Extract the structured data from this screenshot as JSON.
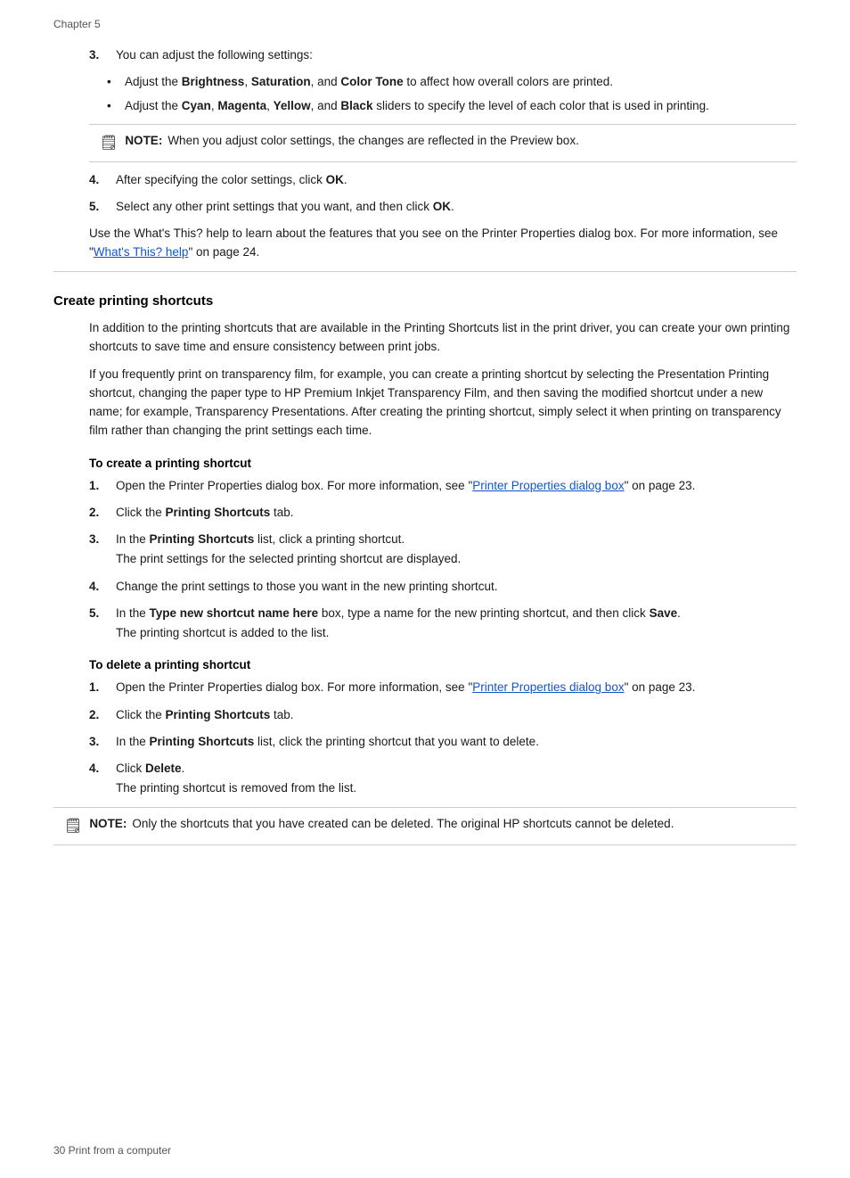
{
  "chapter": "Chapter 5",
  "footer": "30    Print from a computer",
  "step3_intro": "You can adjust the following settings:",
  "bullet1": "Adjust the ",
  "bullet1_bold": "Brightness",
  "bullet1_and": ", ",
  "bullet1_bold2": "Saturation",
  "bullet1_and2": ", and ",
  "bullet1_bold3": "Color Tone",
  "bullet1_rest": " to affect how overall colors are printed.",
  "bullet2": "Adjust the ",
  "bullet2_bold1": "Cyan",
  "bullet2_and1": ", ",
  "bullet2_bold2": "Magenta",
  "bullet2_and2": ", ",
  "bullet2_bold3": "Yellow",
  "bullet2_and3": ", and ",
  "bullet2_bold4": "Black",
  "bullet2_rest": " sliders to specify the level of each color that is used in printing.",
  "note1_label": "NOTE:",
  "note1_text": "When you adjust color settings, the changes are reflected in the Preview box.",
  "step4": "After specifying the color settings, click ",
  "step4_bold": "OK",
  "step4_end": ".",
  "step5": "Select any other print settings that you want, and then click ",
  "step5_bold": "OK",
  "step5_end": ".",
  "para_whatsthis": "Use the What's This? help to learn about the features that you see on the Printer Properties dialog box. For more information, see “",
  "whatsthis_link": "What's This? help",
  "whatsthis_link_ref": " on page 24",
  "whatsthis_end": ".",
  "section_title": "Create printing shortcuts",
  "intro_para1": "In addition to the printing shortcuts that are available in the Printing Shortcuts list in the print driver, you can create your own printing shortcuts to save time and ensure consistency between print jobs.",
  "intro_para2": "If you frequently print on transparency film, for example, you can create a printing shortcut by selecting the Presentation Printing shortcut, changing the paper type to HP Premium Inkjet Transparency Film, and then saving the modified shortcut under a new name; for example, Transparency Presentations. After creating the printing shortcut, simply select it when printing on transparency film rather than changing the print settings each time.",
  "create_heading": "To create a printing shortcut",
  "create_step1_pre": "Open the Printer Properties dialog box. For more information, see “",
  "create_step1_link": "Printer Properties dialog box",
  "create_step1_ref": "” on page 23",
  "create_step1_end": ".",
  "create_step2": "Click the ",
  "create_step2_bold": "Printing Shortcuts",
  "create_step2_end": " tab.",
  "create_step3": "In the ",
  "create_step3_bold": "Printing Shortcuts",
  "create_step3_rest": " list, click a printing shortcut.",
  "create_step3_sub": "The print settings for the selected printing shortcut are displayed.",
  "create_step4": "Change the print settings to those you want in the new printing shortcut.",
  "create_step5": "In the ",
  "create_step5_bold": "Type new shortcut name here",
  "create_step5_rest": " box, type a name for the new printing shortcut, and then click ",
  "create_step5_save": "Save",
  "create_step5_end": ".",
  "create_step5_sub": "The printing shortcut is added to the list.",
  "delete_heading": "To delete a printing shortcut",
  "delete_step1_pre": "Open the Printer Properties dialog box. For more information, see “",
  "delete_step1_link": "Printer Properties dialog box",
  "delete_step1_ref": "” on page 23",
  "delete_step1_end": ".",
  "delete_step2": "Click the ",
  "delete_step2_bold": "Printing Shortcuts",
  "delete_step2_end": " tab.",
  "delete_step3": "In the ",
  "delete_step3_bold": "Printing Shortcuts",
  "delete_step3_rest": " list, click the printing shortcut that you want to delete.",
  "delete_step4": "Click ",
  "delete_step4_bold": "Delete",
  "delete_step4_end": ".",
  "delete_step4_sub": "The printing shortcut is removed from the list.",
  "note2_label": "NOTE:",
  "note2_text": "Only the shortcuts that you have created can be deleted. The original HP shortcuts cannot be deleted."
}
